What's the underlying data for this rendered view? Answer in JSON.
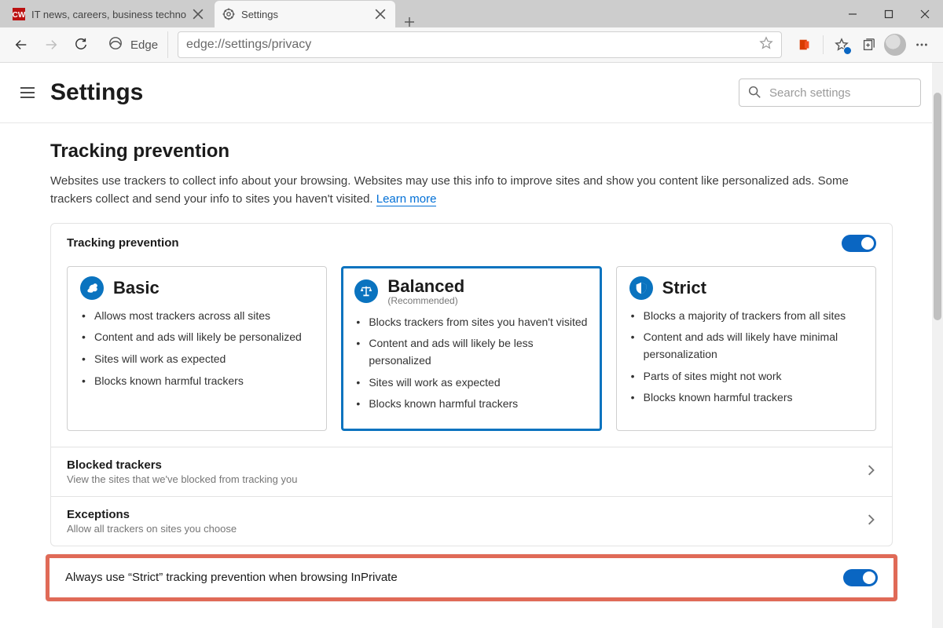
{
  "window": {
    "tabs": [
      {
        "label": "IT news, careers, business techno",
        "active": false
      },
      {
        "label": "Settings",
        "active": true
      }
    ]
  },
  "toolbar": {
    "identity_label": "Edge",
    "url": "edge://settings/privacy"
  },
  "header": {
    "title": "Settings",
    "search_placeholder": "Search settings"
  },
  "tracking": {
    "section_title": "Tracking prevention",
    "desc_a": "Websites use trackers to collect info about your browsing. Websites may use this info to improve sites and show you content like personalized ads. Some trackers collect and send your info to sites you haven't visited. ",
    "learn_more": "Learn more",
    "panel_label": "Tracking prevention",
    "cards": [
      {
        "title": "Basic",
        "sub": "",
        "bullets": [
          "Allows most trackers across all sites",
          "Content and ads will likely be personalized",
          "Sites will work as expected",
          "Blocks known harmful trackers"
        ],
        "selected": false,
        "icon": "squirrel"
      },
      {
        "title": "Balanced",
        "sub": "(Recommended)",
        "bullets": [
          "Blocks trackers from sites you haven't visited",
          "Content and ads will likely be less personalized",
          "Sites will work as expected",
          "Blocks known harmful trackers"
        ],
        "selected": true,
        "icon": "scales"
      },
      {
        "title": "Strict",
        "sub": "",
        "bullets": [
          "Blocks a majority of trackers from all sites",
          "Content and ads will likely have minimal personalization",
          "Parts of sites might not work",
          "Blocks known harmful trackers"
        ],
        "selected": false,
        "icon": "shield"
      }
    ],
    "rows": {
      "blocked": {
        "title": "Blocked trackers",
        "sub": "View the sites that we've blocked from tracking you"
      },
      "exceptions": {
        "title": "Exceptions",
        "sub": "Allow all trackers on sites you choose"
      },
      "inprivate": {
        "title": "Always use “Strict” tracking prevention when browsing InPrivate"
      }
    }
  }
}
